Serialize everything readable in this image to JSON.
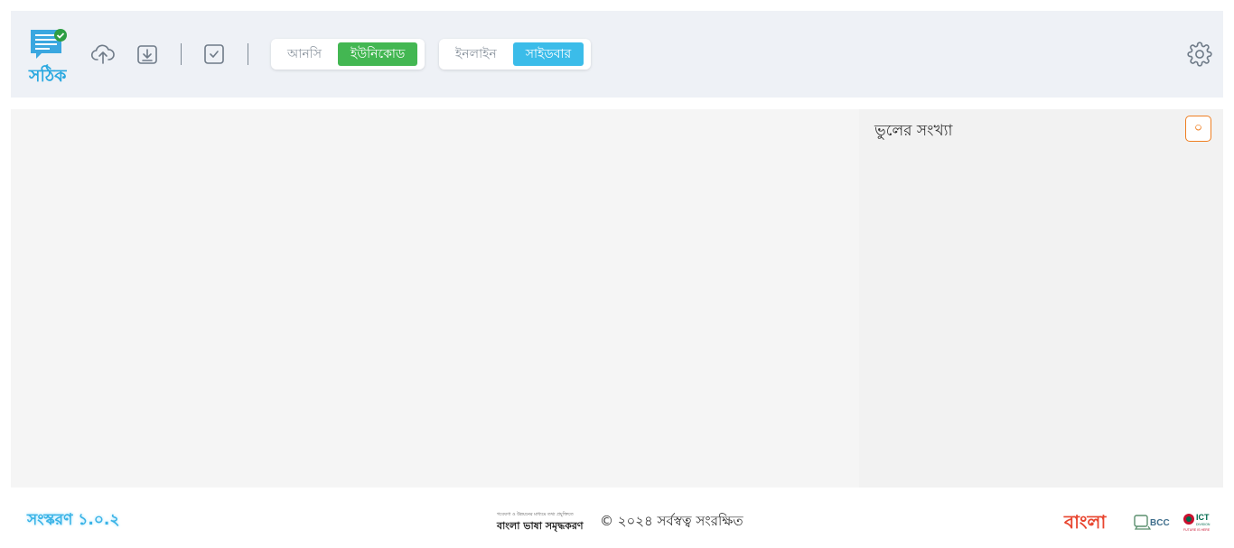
{
  "app": {
    "name": "সঠিক"
  },
  "toolbar": {
    "upload_icon": "cloud-upload-icon",
    "download_icon": "download-icon",
    "check_icon": "checkbox-check-icon",
    "encoding": {
      "options": [
        "আনসি",
        "ইউনিকোড"
      ],
      "selected": "ইউনিকোড"
    },
    "view": {
      "options": [
        "ইনলাইন",
        "সাইডবার"
      ],
      "selected": "সাইডবার"
    },
    "settings_icon": "gear-icon"
  },
  "sidebar": {
    "error_label": "ভুলের সংখ্যা",
    "error_count": "০"
  },
  "footer": {
    "version": "সংস্করণ ১.০.২",
    "bvs_small": "গবেষণা ও উন্নয়নের মাধ্যমে তথ্য প্রযুক্তিতে",
    "bvs_main": "বাংলা ভাষা সমৃদ্ধকরণ",
    "copyright": "© ২০২৪ সর্বস্বত্ব সংরক্ষিত",
    "logo_bangla": "বাংলা",
    "logo_bcc": "BCC",
    "logo_ict": "ICT",
    "logo_ict_sub": "DIVISION",
    "logo_ict_tag": "FUTURE IS HERE"
  },
  "colors": {
    "accent_green": "#43b752",
    "accent_blue": "#3bbce9",
    "count_orange": "#ef7f22"
  }
}
